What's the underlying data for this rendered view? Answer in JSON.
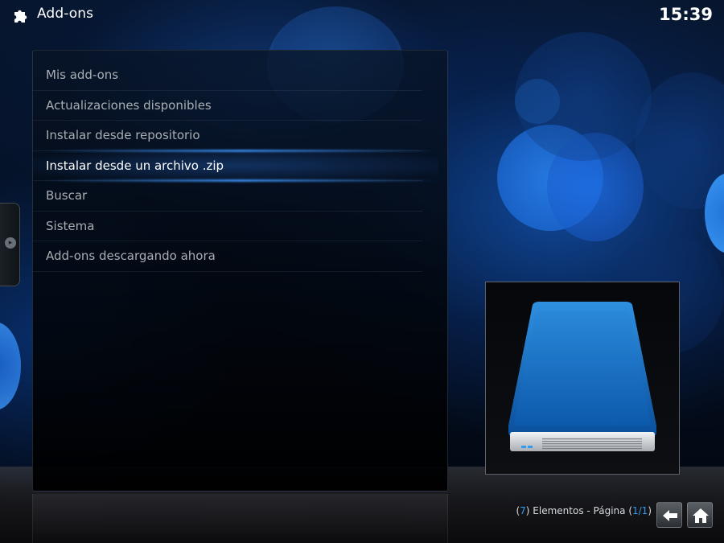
{
  "header": {
    "title": "Add-ons",
    "icon": "puzzle-piece-icon",
    "clock": "15:39"
  },
  "menu": {
    "items": [
      {
        "label": "Mis add-ons",
        "selected": false
      },
      {
        "label": "Actualizaciones disponibles",
        "selected": false
      },
      {
        "label": "Instalar desde repositorio",
        "selected": false
      },
      {
        "label": "Instalar desde un archivo .zip",
        "selected": true
      },
      {
        "label": "Buscar",
        "selected": false
      },
      {
        "label": "Sistema",
        "selected": false
      },
      {
        "label": "Add-ons descargando ahora",
        "selected": false
      }
    ]
  },
  "thumbnail": {
    "icon": "hard-drive-icon"
  },
  "footer": {
    "count": "7",
    "elements_label": "Elementos - Página",
    "page": "1/1",
    "back_icon": "back-arrow-icon",
    "home_icon": "home-icon"
  },
  "colors": {
    "accent": "#2e9bf0",
    "text_inactive": "#a9aeb3",
    "text_active": "#ffffff"
  }
}
